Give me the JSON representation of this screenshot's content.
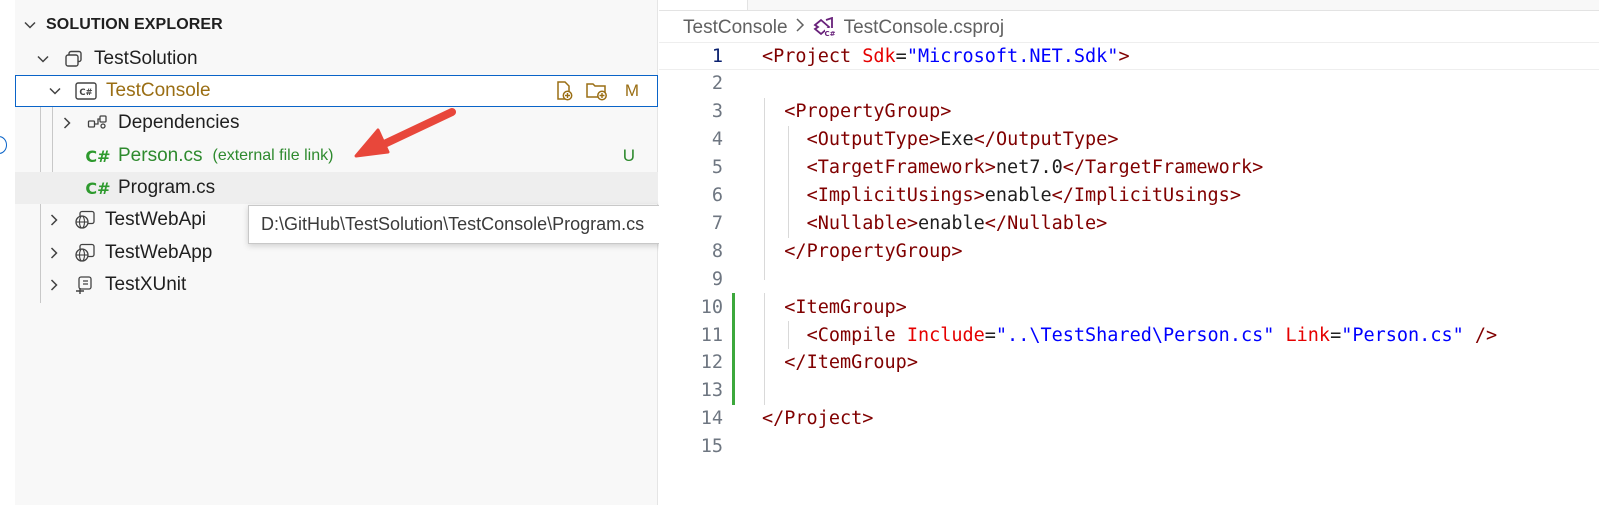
{
  "explorer": {
    "title": "SOLUTION EXPLORER",
    "items": [
      {
        "label": "TestSolution",
        "icon": "solution-icon"
      },
      {
        "label": "TestConsole",
        "icon": "csharp-project-icon",
        "badge": "M"
      },
      {
        "label": "Dependencies",
        "icon": "dependencies-icon"
      },
      {
        "label": "Person.cs",
        "icon": "csharp-file-icon",
        "note": "(external file link)",
        "badge": "U"
      },
      {
        "label": "Program.cs",
        "icon": "csharp-file-icon"
      },
      {
        "label": "TestWebApi",
        "icon": "web-project-icon"
      },
      {
        "label": "TestWebApp",
        "icon": "web-project-icon"
      },
      {
        "label": "TestXUnit",
        "icon": "test-project-icon"
      }
    ],
    "csharp_glyph": "C#",
    "project_glyph": "C#"
  },
  "tooltip": {
    "text": "D:\\GitHub\\TestSolution\\TestConsole\\Program.cs"
  },
  "breadcrumb": {
    "project": "TestConsole",
    "file": "TestConsole.csproj"
  },
  "editor": {
    "lines": [
      {
        "n": "1",
        "tokens": [
          [
            "d",
            "<"
          ],
          [
            "t",
            "Project"
          ],
          [
            "x",
            " "
          ],
          [
            "a",
            "Sdk"
          ],
          [
            "x",
            "="
          ],
          [
            "s",
            "\"Microsoft.NET.Sdk\""
          ],
          [
            "d",
            ">"
          ]
        ]
      },
      {
        "n": "2",
        "tokens": []
      },
      {
        "n": "3",
        "tokens": [
          [
            "x",
            "  "
          ],
          [
            "d",
            "<"
          ],
          [
            "t",
            "PropertyGroup"
          ],
          [
            "d",
            ">"
          ]
        ]
      },
      {
        "n": "4",
        "tokens": [
          [
            "x",
            "    "
          ],
          [
            "d",
            "<"
          ],
          [
            "t",
            "OutputType"
          ],
          [
            "d",
            ">"
          ],
          [
            "x",
            "Exe"
          ],
          [
            "d",
            "</"
          ],
          [
            "t",
            "OutputType"
          ],
          [
            "d",
            ">"
          ]
        ]
      },
      {
        "n": "5",
        "tokens": [
          [
            "x",
            "    "
          ],
          [
            "d",
            "<"
          ],
          [
            "t",
            "TargetFramework"
          ],
          [
            "d",
            ">"
          ],
          [
            "x",
            "net7.0"
          ],
          [
            "d",
            "</"
          ],
          [
            "t",
            "TargetFramework"
          ],
          [
            "d",
            ">"
          ]
        ]
      },
      {
        "n": "6",
        "tokens": [
          [
            "x",
            "    "
          ],
          [
            "d",
            "<"
          ],
          [
            "t",
            "ImplicitUsings"
          ],
          [
            "d",
            ">"
          ],
          [
            "x",
            "enable"
          ],
          [
            "d",
            "</"
          ],
          [
            "t",
            "ImplicitUsings"
          ],
          [
            "d",
            ">"
          ]
        ]
      },
      {
        "n": "7",
        "tokens": [
          [
            "x",
            "    "
          ],
          [
            "d",
            "<"
          ],
          [
            "t",
            "Nullable"
          ],
          [
            "d",
            ">"
          ],
          [
            "x",
            "enable"
          ],
          [
            "d",
            "</"
          ],
          [
            "t",
            "Nullable"
          ],
          [
            "d",
            ">"
          ]
        ]
      },
      {
        "n": "8",
        "tokens": [
          [
            "x",
            "  "
          ],
          [
            "d",
            "</"
          ],
          [
            "t",
            "PropertyGroup"
          ],
          [
            "d",
            ">"
          ]
        ]
      },
      {
        "n": "9",
        "tokens": []
      },
      {
        "n": "10",
        "tokens": [
          [
            "x",
            "  "
          ],
          [
            "d",
            "<"
          ],
          [
            "t",
            "ItemGroup"
          ],
          [
            "d",
            ">"
          ]
        ]
      },
      {
        "n": "11",
        "tokens": [
          [
            "x",
            "    "
          ],
          [
            "d",
            "<"
          ],
          [
            "t",
            "Compile"
          ],
          [
            "x",
            " "
          ],
          [
            "a",
            "Include"
          ],
          [
            "x",
            "="
          ],
          [
            "s",
            "\"..\\TestShared\\Person.cs\""
          ],
          [
            "x",
            " "
          ],
          [
            "a",
            "Link"
          ],
          [
            "x",
            "="
          ],
          [
            "s",
            "\"Person.cs\""
          ],
          [
            "x",
            " "
          ],
          [
            "d",
            "/>"
          ]
        ]
      },
      {
        "n": "12",
        "tokens": [
          [
            "x",
            "  "
          ],
          [
            "d",
            "</"
          ],
          [
            "t",
            "ItemGroup"
          ],
          [
            "d",
            ">"
          ]
        ]
      },
      {
        "n": "13",
        "tokens": []
      },
      {
        "n": "14",
        "tokens": [
          [
            "d",
            "</"
          ],
          [
            "t",
            "Project"
          ],
          [
            "d",
            ">"
          ]
        ]
      },
      {
        "n": "15",
        "tokens": []
      }
    ],
    "active_line": "1"
  },
  "colors": {
    "selection_border": "#0a64c8",
    "git_modified": "#9a6e14",
    "git_untracked": "#2e8a2e",
    "xml_tag": "#800000",
    "xml_attr": "#e50000",
    "xml_string": "#0000ff",
    "gutter_added": "#3ca83c",
    "arrow": "#e8473b"
  }
}
